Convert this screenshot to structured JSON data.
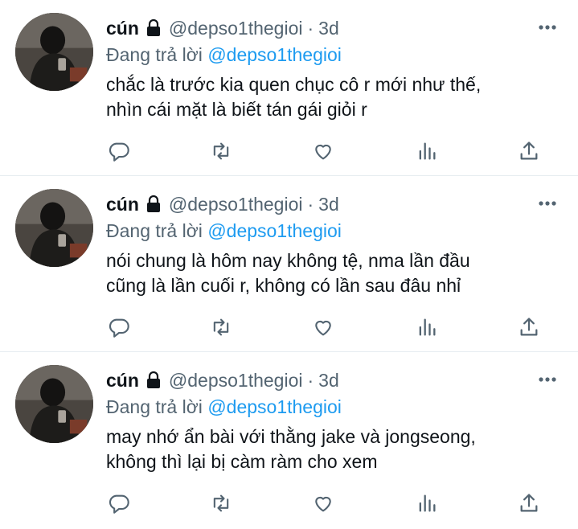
{
  "tweets": [
    {
      "name": "cún",
      "handle": "@depso1thegioi",
      "separator": "·",
      "time": "3d",
      "reply_prefix": "Đang trả lời",
      "reply_to": "@depso1thegioi",
      "text_lines": [
        "chắc là trước kia quen chục cô r mới như thế,",
        "nhìn cái mặt là biết tán gái giỏi r"
      ]
    },
    {
      "name": "cún",
      "handle": "@depso1thegioi",
      "separator": "·",
      "time": "3d",
      "reply_prefix": "Đang trả lời",
      "reply_to": "@depso1thegioi",
      "text_lines": [
        "nói chung là hôm nay không tệ, nma lần đầu",
        "cũng là lần cuối r, không có lần sau đâu nhỉ"
      ]
    },
    {
      "name": "cún",
      "handle": "@depso1thegioi",
      "separator": "·",
      "time": "3d",
      "reply_prefix": "Đang trả lời",
      "reply_to": "@depso1thegioi",
      "text_lines": [
        "may nhớ ẩn bài với thằng jake và jongseong,",
        "không thì lại bị càm ràm cho xem"
      ]
    }
  ],
  "icons": {
    "lock": "lock-icon",
    "more": "more-icon",
    "reply": "reply-icon",
    "retweet": "retweet-icon",
    "like": "like-icon",
    "views": "analytics-icon",
    "share": "share-icon"
  },
  "colors": {
    "text": "#0f1419",
    "secondary": "#536471",
    "link": "#1d9bf0",
    "divider": "#e6ecf0"
  }
}
